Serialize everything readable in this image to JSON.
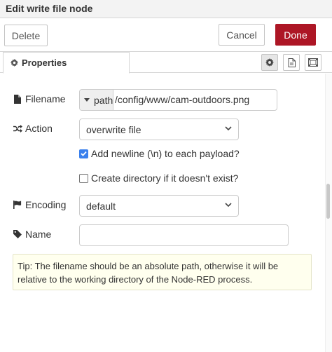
{
  "tray": {
    "title": "Edit write file node"
  },
  "toolbar": {
    "delete_label": "Delete",
    "cancel_label": "Cancel",
    "done_label": "Done"
  },
  "tabs": {
    "properties_label": "Properties",
    "icon_buttons": [
      "gear-icon",
      "document-icon",
      "layout-icon"
    ]
  },
  "form": {
    "filename": {
      "label": "Filename",
      "type": "path",
      "value": "/config/www/cam-outdoors.png"
    },
    "action": {
      "label": "Action",
      "selected": "overwrite file"
    },
    "add_newline": {
      "label": "Add newline (\\n) to each payload?",
      "checked": true
    },
    "create_directory": {
      "label": "Create directory if it doesn't exist?",
      "checked": false
    },
    "encoding": {
      "label": "Encoding",
      "selected": "default"
    },
    "name": {
      "label": "Name",
      "value": ""
    }
  },
  "tip": {
    "text": "Tip: The filename should be an absolute path, otherwise it will be relative to the working directory of the Node-RED process."
  },
  "colors": {
    "done_button": "#ad1625",
    "checkbox_checked": "#3a80ed",
    "tip_background": "#ffffee"
  }
}
